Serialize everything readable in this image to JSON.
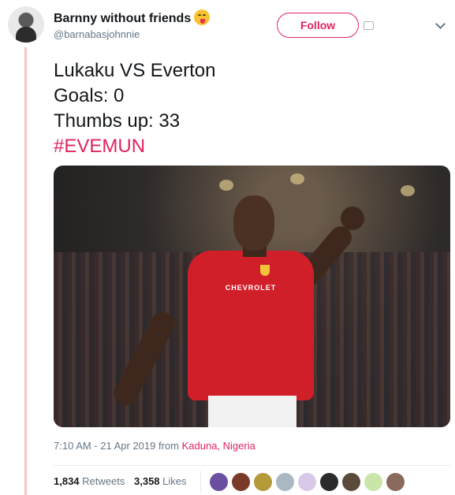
{
  "author": {
    "display_name": "Barnny without friends",
    "handle": "@barnabasjohnnie"
  },
  "follow_label": "Follow",
  "tweet": {
    "lines": [
      "Lukaku VS Everton",
      "Goals: 0",
      "Thumbs up: 33"
    ],
    "hashtag": "#EVEMUN"
  },
  "photo": {
    "sponsor_text": "CHEVROLET"
  },
  "meta": {
    "timestamp": "7:10 AM - 21 Apr 2019 from",
    "location": "Kaduna, Nigeria"
  },
  "stats": {
    "retweets_count": "1,834",
    "retweets_label": "Retweets",
    "likes_count": "3,358",
    "likes_label": "Likes"
  },
  "liker_avatar_colors": [
    "#6b4fa1",
    "#7a3a2a",
    "#b59a3a",
    "#aab8c2",
    "#d8c9e8",
    "#2b2b2b",
    "#5a4a3a",
    "#c9e6a8",
    "#8a6a5a"
  ],
  "colors": {
    "accent": "#e0245e",
    "secondary_text": "#657786"
  }
}
